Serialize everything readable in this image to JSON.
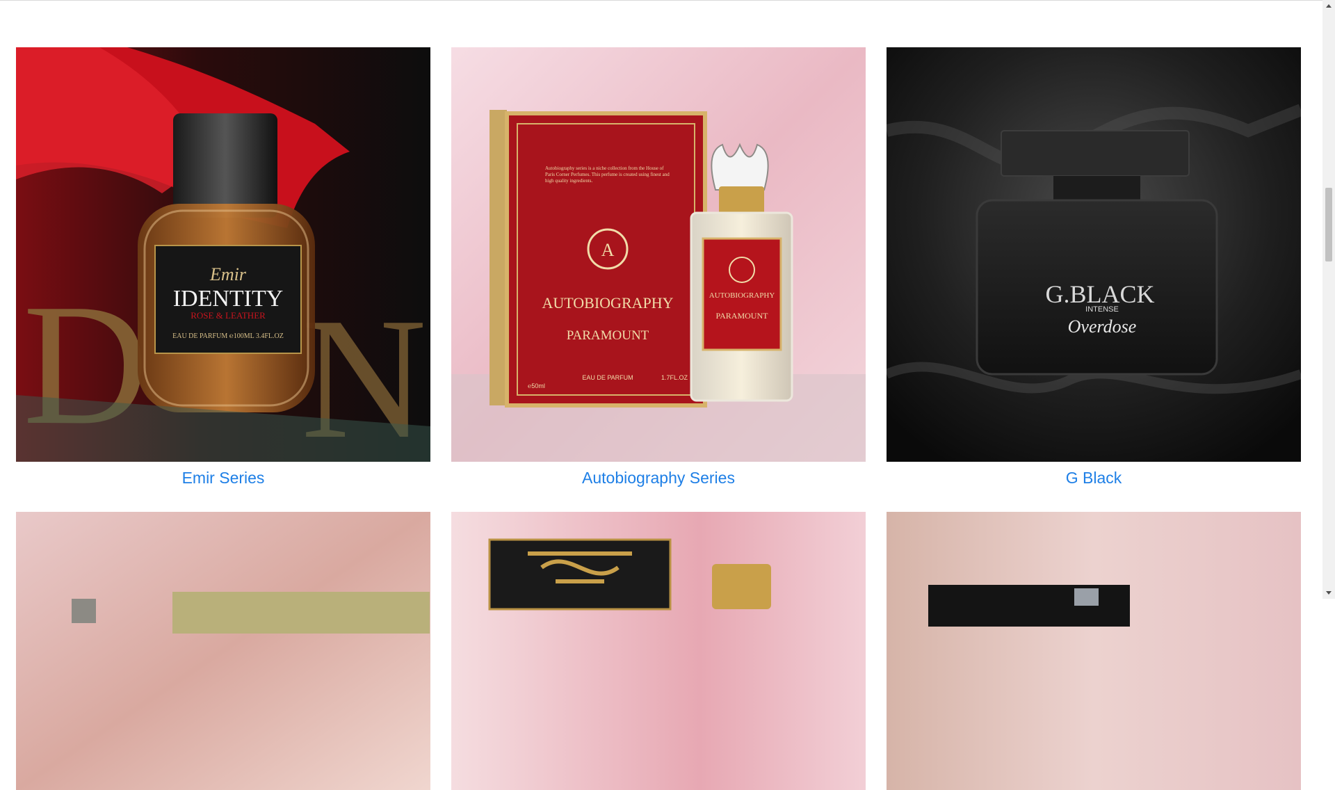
{
  "products": [
    {
      "caption": "Emir Series",
      "image": "Emir Identity perfume bottle",
      "label_brand": "Emir",
      "label_name": "IDENTITY",
      "label_sub": "ROSE & LEATHER",
      "label_size": "EAU DE PARFUM ℮100ML 3.4FL.OZ"
    },
    {
      "caption": "Autobiography Series",
      "image": "Autobiography Paramount perfume box and bottle",
      "box_title": "AUTOBIOGRAPHY",
      "box_name": "PARAMOUNT",
      "box_text": "Autobiography series is a niche collection from the House of Paris Corner Perfumes. This perfume is created using finest and high quality ingredients.",
      "box_foot_left": "℮50ml",
      "box_foot_mid": "EAU DE PARFUM",
      "box_foot_right": "1.7FL.OZ"
    },
    {
      "caption": "G Black",
      "image": "G Black Intense Overdose perfume bottle",
      "label_main": "G.BLACK",
      "label_sub": "INTENSE",
      "label_script": "Overdose"
    }
  ],
  "products_row2": [
    {
      "image": "perfume product photo"
    },
    {
      "image": "perfume box with ornate gold pattern"
    },
    {
      "image": "perfume product photo"
    }
  ],
  "colors": {
    "link": "#1e7fe6"
  }
}
